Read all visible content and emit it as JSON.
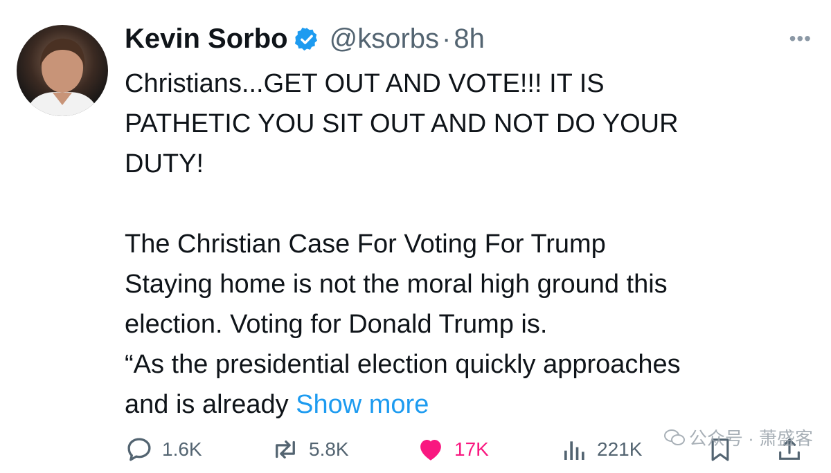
{
  "author": {
    "name": "Kevin Sorbo",
    "handle": "@ksorbs",
    "separator": "·",
    "time": "8h",
    "verified_icon": "verified-badge-icon",
    "avatar_description": "profile-photo"
  },
  "menu": {
    "more_label": "•••"
  },
  "tweet": {
    "lines_a": [
      "Christians...GET OUT AND VOTE!!!  IT IS",
      "PATHETIC YOU SIT OUT AND NOT DO YOUR",
      "DUTY!"
    ],
    "lines_b": [
      "The Christian Case For Voting For Trump",
      "Staying home is not the moral high ground this",
      "election. Voting for Donald Trump is.",
      "“As the presidential election quickly approaches"
    ],
    "last_line_text": "and is already ",
    "show_more": "Show more"
  },
  "actions": {
    "replies": "1.6K",
    "reposts": "5.8K",
    "likes": "17K",
    "views": "221K"
  },
  "colors": {
    "text": "#0f1419",
    "muted": "#536471",
    "link": "#1d9bf0",
    "like": "#f91880",
    "verified": "#1d9bf0"
  },
  "watermark": {
    "text": "公众号 · 萧盛客"
  }
}
